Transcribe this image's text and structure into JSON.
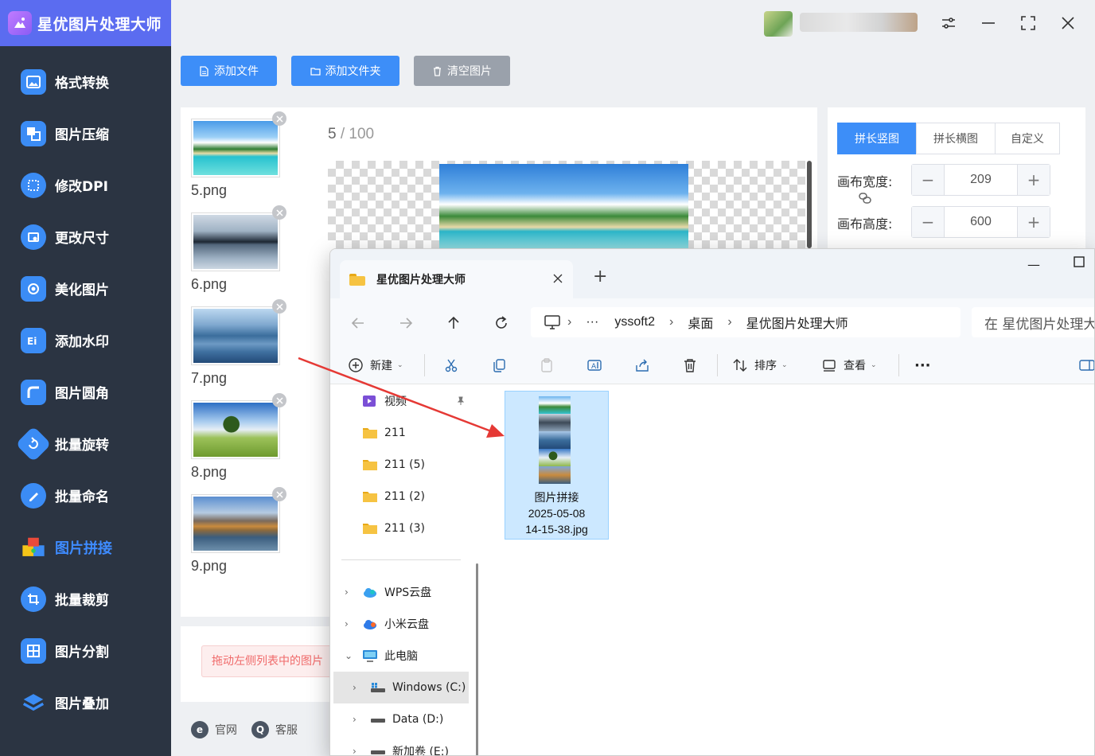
{
  "app": {
    "title": "星优图片处理大师",
    "accent": "#3d8ef8",
    "sidebar_bg": "#2b3442",
    "header_bg": "#5b6cf0"
  },
  "sidebar": {
    "items": [
      {
        "label": "格式转换",
        "icon": "image-convert-icon",
        "color": "#3b8cf5"
      },
      {
        "label": "图片压缩",
        "icon": "compress-icon",
        "color": "#3b8cf5"
      },
      {
        "label": "修改DPI",
        "icon": "dpi-icon",
        "color": "#3b8cf5"
      },
      {
        "label": "更改尺寸",
        "icon": "resize-icon",
        "color": "#3b8cf5"
      },
      {
        "label": "美化图片",
        "icon": "beautify-icon",
        "color": "#3b8cf5"
      },
      {
        "label": "添加水印",
        "icon": "watermark-icon",
        "color": "#3b8cf5"
      },
      {
        "label": "图片圆角",
        "icon": "round-corner-icon",
        "color": "#3b8cf5"
      },
      {
        "label": "批量旋转",
        "icon": "rotate-icon",
        "color": "#3b8cf5"
      },
      {
        "label": "批量命名",
        "icon": "rename-icon",
        "color": "#3b8cf5"
      },
      {
        "label": "图片拼接",
        "icon": "puzzle-icon",
        "color": "#ea4a3a",
        "active": true
      },
      {
        "label": "批量裁剪",
        "icon": "crop-icon",
        "color": "#3b8cf5"
      },
      {
        "label": "图片分割",
        "icon": "split-icon",
        "color": "#3b8cf5"
      },
      {
        "label": "图片叠加",
        "icon": "layers-icon",
        "color": "#3b8cf5"
      }
    ]
  },
  "toolbar": {
    "add_file": "添加文件",
    "add_folder": "添加文件夹",
    "clear": "清空图片"
  },
  "thumbnails": [
    {
      "name": "5.png",
      "icon": "beach-thumbnail"
    },
    {
      "name": "6.png",
      "icon": "mountain-lake-thumbnail"
    },
    {
      "name": "7.png",
      "icon": "blue-mountains-thumbnail"
    },
    {
      "name": "8.png",
      "icon": "tree-field-thumbnail"
    },
    {
      "name": "9.png",
      "icon": "autumn-lake-thumbnail"
    }
  ],
  "preview": {
    "current": "5",
    "total": "100"
  },
  "hint": "拖动左侧列表中的图片",
  "footer": {
    "website": "官网",
    "support": "客服"
  },
  "settings": {
    "tabs": [
      "拼长竖图",
      "拼长横图",
      "自定义"
    ],
    "active_tab": 0,
    "width_label": "画布宽度:",
    "width_value": "209",
    "height_label": "画布高度:",
    "height_value": "600"
  },
  "explorer": {
    "tab_title": "星优图片处理大师",
    "breadcrumb": [
      "yssoft2",
      "桌面",
      "星优图片处理大师"
    ],
    "ellipsis": "···",
    "search_placeholder": "在 星优图片处理大",
    "commands": {
      "new": "新建",
      "sort": "排序",
      "view": "查看",
      "more": "···"
    },
    "nav_items": [
      {
        "label": "视频",
        "icon": "video-folder-icon"
      },
      {
        "label": "211",
        "icon": "folder-icon"
      },
      {
        "label": "211 (5)",
        "icon": "folder-icon"
      },
      {
        "label": "211 (2)",
        "icon": "folder-icon"
      },
      {
        "label": "211 (3)",
        "icon": "folder-icon"
      },
      {
        "label": "WPS云盘",
        "icon": "wps-cloud-icon"
      },
      {
        "label": "小米云盘",
        "icon": "xiaomi-cloud-icon"
      },
      {
        "label": "此电脑",
        "icon": "computer-icon"
      },
      {
        "label": "Windows (C:)",
        "icon": "drive-icon"
      },
      {
        "label": "Data (D:)",
        "icon": "drive-icon"
      },
      {
        "label": "新加卷 (E:)",
        "icon": "drive-icon"
      }
    ],
    "file": {
      "name_line1": "图片拼接",
      "name_line2": "2025-05-08",
      "name_line3": "14-15-38.jpg"
    }
  }
}
